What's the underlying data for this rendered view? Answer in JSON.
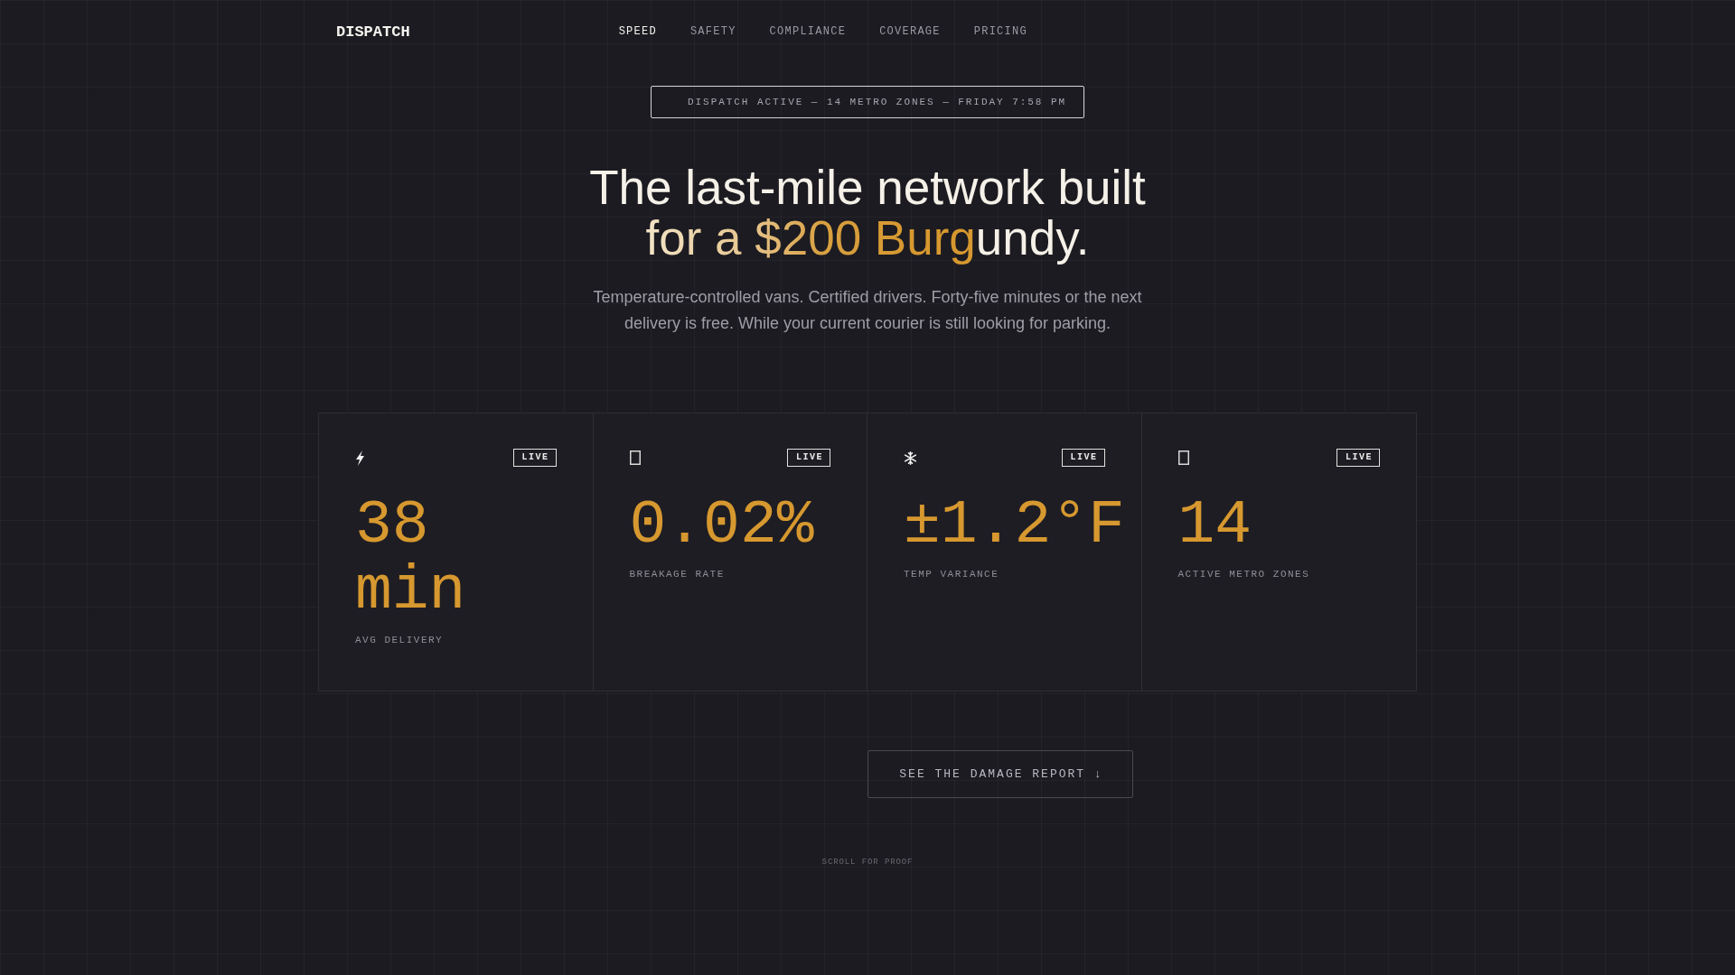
{
  "brand": {
    "logo": "DISPATCH"
  },
  "nav": [
    {
      "label": "SPEED",
      "selected": true
    },
    {
      "label": "SAFETY",
      "selected": false
    },
    {
      "label": "COMPLIANCE",
      "selected": false
    },
    {
      "label": "COVERAGE",
      "selected": false
    },
    {
      "label": "PRICING",
      "selected": false
    }
  ],
  "status_banner": {
    "text": "DISPATCH ACTIVE — 14 METRO ZONES — FRIDAY 7:58 PM"
  },
  "hero": {
    "headline": "The last-mile network built",
    "headline_accent": "for a $200 Burgundy.",
    "subtitle": "Temperature-controlled vans. Certified drivers. Forty-five minutes or the next delivery is free. While your current courier is still looking for parking."
  },
  "stats": [
    {
      "badge": "LIVE",
      "value": "38 min",
      "label": "AVG DELIVERY"
    },
    {
      "badge": "LIVE",
      "value": "0.02%",
      "label": "BREAKAGE RATE"
    },
    {
      "badge": "LIVE",
      "value": "±1.2°F",
      "label": "TEMP VARIANCE"
    },
    {
      "badge": "LIVE",
      "value": "14",
      "label": "ACTIVE METRO ZONES"
    }
  ],
  "cta": {
    "label": "SEE THE DAMAGE REPORT ↓"
  },
  "scroll_hint": "SCROLL FOR PROOF"
}
